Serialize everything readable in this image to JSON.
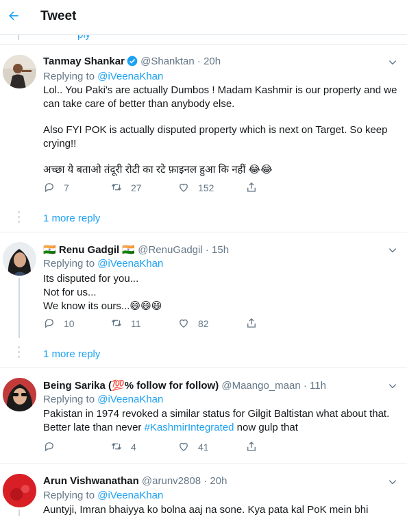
{
  "header": {
    "title": "Tweet"
  },
  "partial_above": {
    "text": "ply"
  },
  "tweets": [
    {
      "name": "Tanmay Shankar",
      "handle": "@Shanktan",
      "sep": "·",
      "time": "20h",
      "verified": true,
      "replying_label": "Replying to",
      "replying_mention": "@iVeenaKhan",
      "lines": [
        "Lol.. You Paki's are actually Dumbos ! Madam Kashmir is our property and we can take care of better than anybody else.",
        "Also FYI POK is actually disputed property which is next on Target. So keep crying!!",
        "अच्छा ये बताओ तंदूरी रोटी का रटे फ़ाइनल हुआ कि नहीं 😂😂"
      ],
      "replies": "7",
      "retweets": "27",
      "likes": "152",
      "more_replies": "1 more reply"
    },
    {
      "name_prefix": "🇮🇳",
      "name": "Renu Gadgil",
      "name_suffix": "🇮🇳",
      "handle": "@RenuGadgil",
      "sep": "·",
      "time": "15h",
      "replying_label": "Replying to",
      "replying_mention": "@iVeenaKhan",
      "lines": [
        "Its disputed for you...",
        "Not for us...",
        "We know its ours...😄😄😄"
      ],
      "replies": "10",
      "retweets": "11",
      "likes": "82",
      "more_replies": "1 more reply"
    },
    {
      "name": "Being Sarika (💯% follow for follow)",
      "handle": "@Maango_maan",
      "sep": "·",
      "time": "11h",
      "replying_label": "Replying to",
      "replying_mention": "@iVeenaKhan",
      "text_before": "Pakistan in 1974 revoked a similar status for Gilgit Baltistan what about that. Better late than never ",
      "hashtag": "#KashmirIntegrated",
      "text_after": " now gulp that",
      "replies": "",
      "retweets": "4",
      "likes": "41"
    },
    {
      "name": "Arun Vishwanathan",
      "handle": "@arunv2808",
      "sep": "·",
      "time": "20h",
      "replying_label": "Replying to",
      "replying_mention": "@iVeenaKhan",
      "lines": [
        "Auntyji, Imran bhaiyya ko bolna aaj na sone. Kya pata kal PoK mein bhi"
      ]
    }
  ],
  "colors": {
    "accent": "#1da1f2",
    "muted": "#657786",
    "border": "#e6ecf0",
    "text": "#14171a"
  }
}
